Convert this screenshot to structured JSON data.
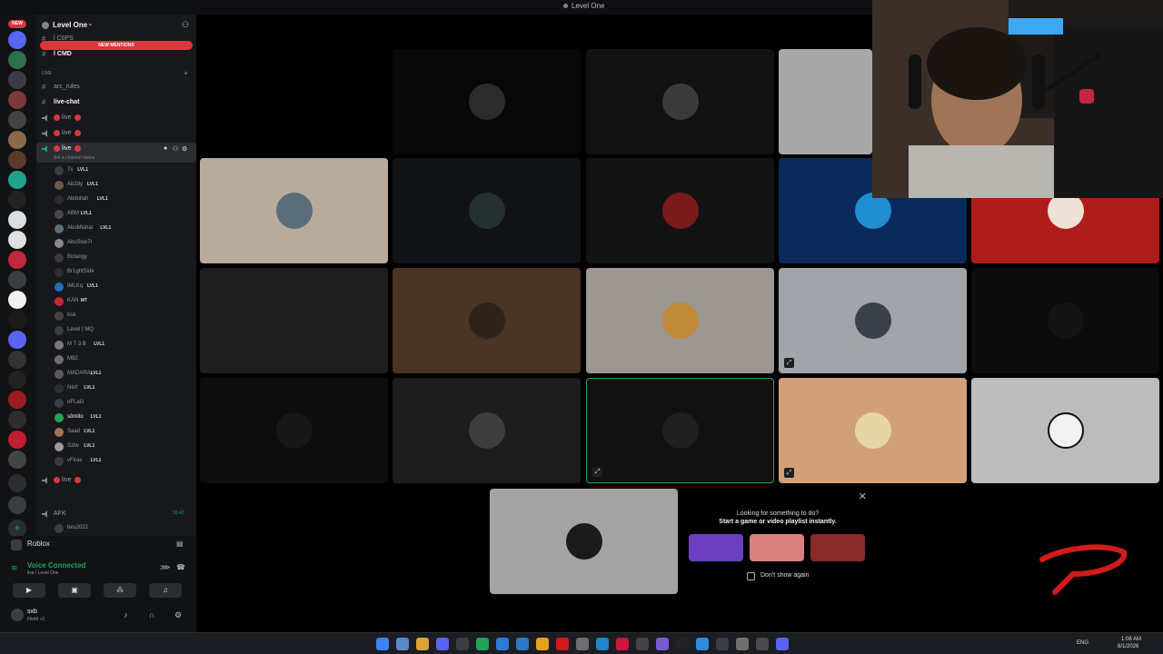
{
  "window": {
    "title": "Level One"
  },
  "server": {
    "name": "Level One",
    "chevron": "⌄"
  },
  "channels": {
    "top_channels": [
      "l C0PS",
      "l CMD"
    ],
    "new_mentions": "NEW MENTIONS",
    "category": "LIVE",
    "arc_rules": "arc_rules",
    "live_chat": "live-chat",
    "live_label": "live",
    "channel_status": "Set a channel status",
    "afk": "AFK",
    "afk_time": "16:42",
    "afk_user": "bes2022"
  },
  "members": [
    {
      "name": "7s",
      "tag": "LVL1"
    },
    {
      "name": "Ab2dy",
      "tag": "LVL1"
    },
    {
      "name": "Abdullah",
      "tag": "LVL1"
    },
    {
      "name": "ABM",
      "tag": "LVL1"
    },
    {
      "name": "AboMishal",
      "tag": "LVL1"
    },
    {
      "name": "AbuSwe7l",
      "tag": ""
    },
    {
      "name": "Botangy",
      "tag": ""
    },
    {
      "name": "Br1ghtSide",
      "tag": ""
    },
    {
      "name": "iMLKq",
      "tag": "LVL1"
    },
    {
      "name": "KAN",
      "tag": "MT"
    },
    {
      "name": "ksa",
      "tag": ""
    },
    {
      "name": "Level | MQ",
      "tag": ""
    },
    {
      "name": "M T 3 B",
      "tag": "LVL1"
    },
    {
      "name": "M92",
      "tag": ""
    },
    {
      "name": "MADARA",
      "tag": "LVL1"
    },
    {
      "name": "Nerf",
      "tag": "LVL1"
    },
    {
      "name": "oFLaG",
      "tag": ""
    },
    {
      "name": "sômito",
      "tag": "LVL1"
    },
    {
      "name": "Saad",
      "tag": "LVL1"
    },
    {
      "name": "Szlw",
      "tag": "LVL1"
    },
    {
      "name": "vFiras",
      "tag": "LVL1"
    }
  ],
  "voice_panel": {
    "activity": "Roblox",
    "status": "Voice Connected",
    "sub": "live / Level One",
    "username": "sxb",
    "user_status": "FlieM +1"
  },
  "activity_card": {
    "line1": "Looking for something to do?",
    "line2": "Start a game or video playlist instantly.",
    "dont_show": "Don't show again",
    "close": "✕"
  },
  "taskbar": {
    "lang": "ENG",
    "time": "1:08 AM",
    "date": "8/1/2026"
  },
  "colors": {
    "accent_green": "#23a55a",
    "danger_red": "#da373c",
    "sidebar_bg": "#17181c"
  }
}
